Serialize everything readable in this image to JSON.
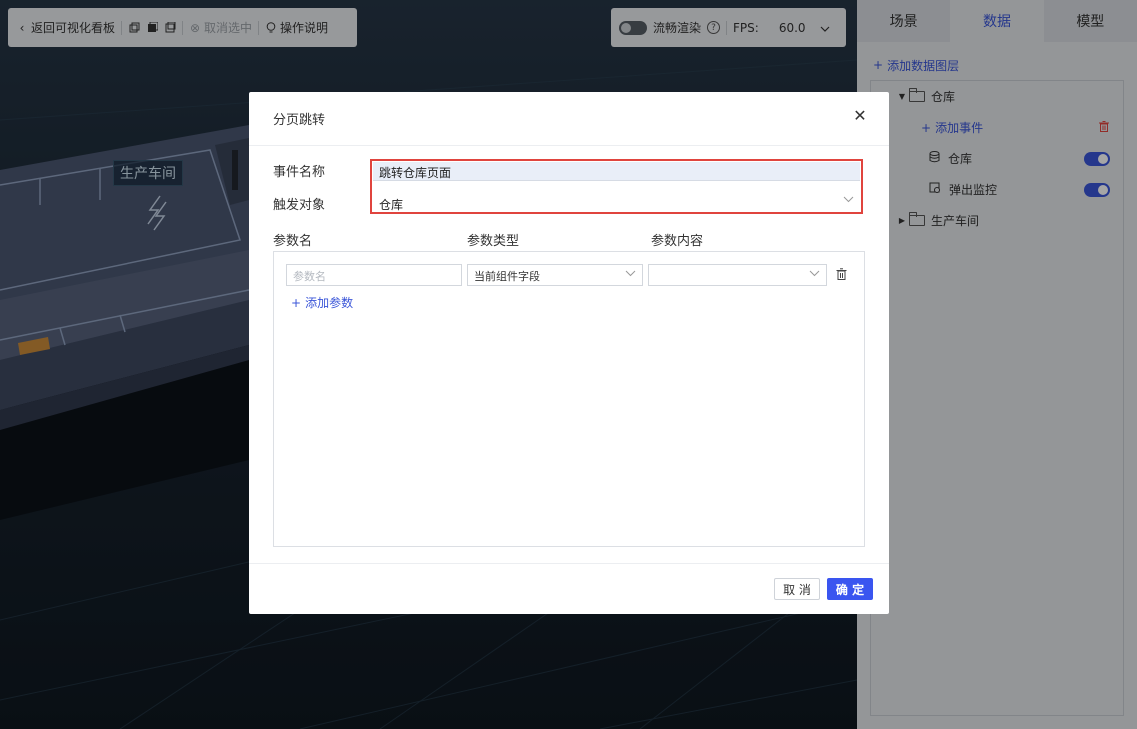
{
  "toolbar_left": {
    "back_label": "返回可视化看板",
    "cancel_select_label": "取消选中",
    "help_label": "操作说明"
  },
  "toolbar_right": {
    "smooth_render_label": "流畅渲染",
    "fps_label": "FPS:",
    "fps_value": "60.0"
  },
  "scene": {
    "building_label": "生产车间"
  },
  "right_panel": {
    "tabs": [
      {
        "label": "场景",
        "active": false
      },
      {
        "label": "数据",
        "active": true
      },
      {
        "label": "模型",
        "active": false
      }
    ],
    "add_layer_label": "添加数据图层",
    "tree": {
      "warehouse_folder": "仓库",
      "add_event_label": "添加事件",
      "warehouse_layer": "仓库",
      "popup_monitor": "弹出监控",
      "workshop_folder": "生产车间"
    }
  },
  "modal": {
    "title": "分页跳转",
    "event_name_label": "事件名称",
    "event_name_value": "跳转仓库页面",
    "trigger_label": "触发对象",
    "trigger_value": "仓库",
    "col_param_name": "参数名",
    "col_param_type": "参数类型",
    "col_param_content": "参数内容",
    "param_name_placeholder": "参数名",
    "param_type_value": "当前组件字段",
    "param_content_value": "",
    "add_param_label": "添加参数",
    "cancel_label": "取 消",
    "ok_label": "确 定"
  },
  "colors": {
    "accent": "#3a55d8",
    "danger": "#e0443e"
  }
}
